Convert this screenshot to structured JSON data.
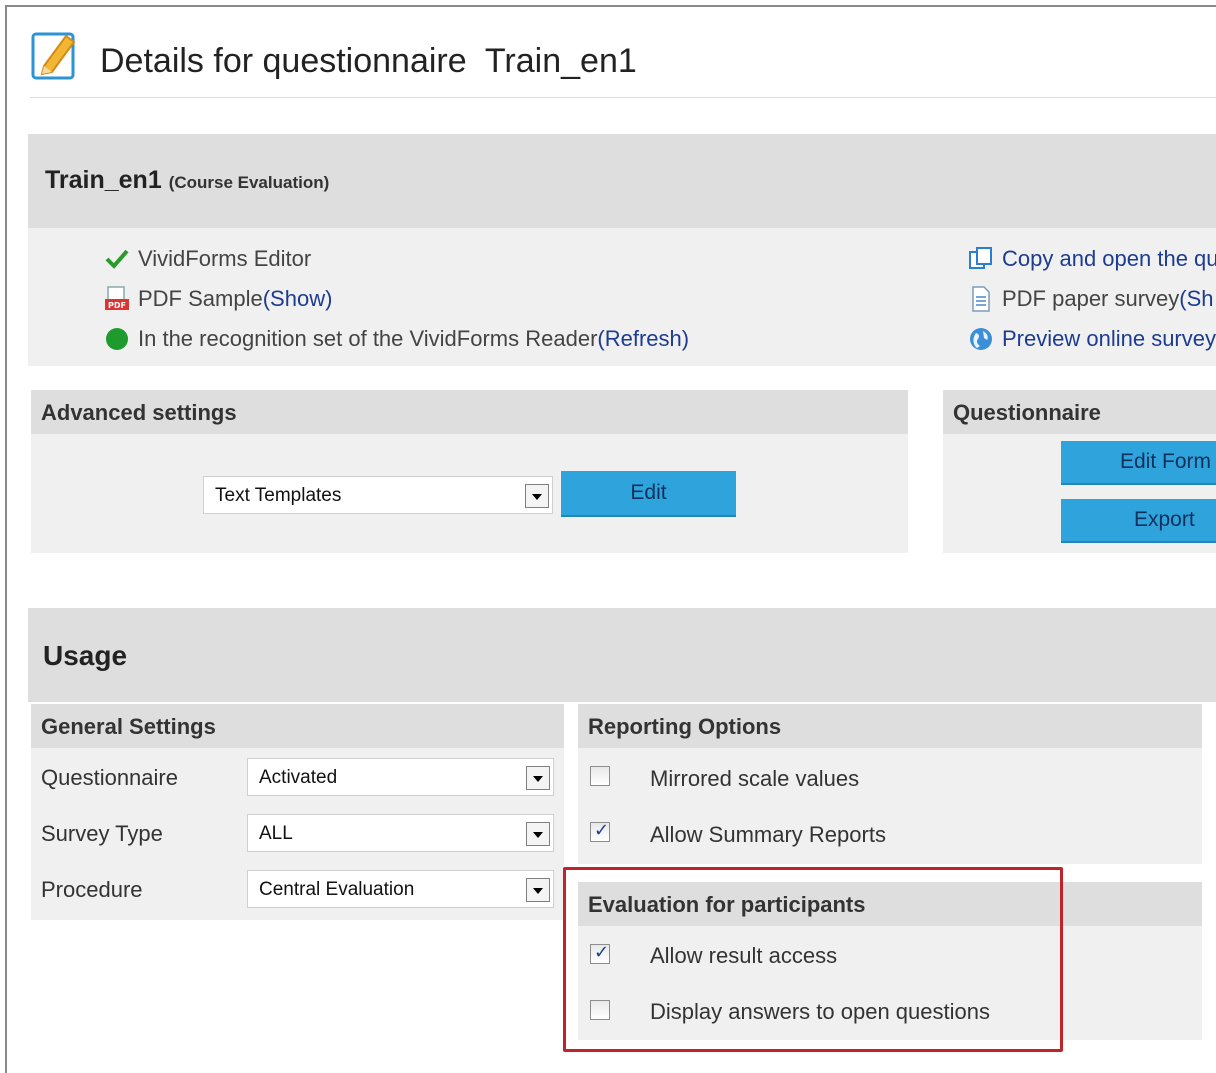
{
  "page": {
    "title": "Details for questionnaire  Train_en1"
  },
  "summary": {
    "name": "Train_en1",
    "type": "(Course Evaluation)",
    "left_items": [
      {
        "text": "VividForms Editor",
        "link": "",
        "icon": "checkmark-icon"
      },
      {
        "text": "PDF Sample ",
        "link": "(Show)",
        "icon": "pdf-icon"
      },
      {
        "text": "In the recognition set of the VividForms Reader ",
        "link": "(Refresh)",
        "icon": "green-status-dot-icon"
      }
    ],
    "right_items": [
      {
        "text": "Copy and open the qu",
        "icon": "copy-icon"
      },
      {
        "text": "PDF paper survey ",
        "link": "(Sh",
        "icon": "document-icon"
      },
      {
        "text": "Preview online survey",
        "icon": "globe-icon"
      }
    ]
  },
  "advanced": {
    "title": "Advanced settings",
    "select_value": "Text Templates",
    "edit_label": "Edit"
  },
  "questionnaire_panel": {
    "title": "Questionnaire",
    "edit_form_label": "Edit Form",
    "export_label": "Export"
  },
  "usage": {
    "title": "Usage",
    "general": {
      "title": "General Settings",
      "fields": [
        {
          "label": "Questionnaire",
          "value": "Activated"
        },
        {
          "label": "Survey Type",
          "value": "ALL"
        },
        {
          "label": "Procedure",
          "value": "Central Evaluation"
        }
      ]
    },
    "reporting": {
      "title": "Reporting Options",
      "options": [
        {
          "label": "Mirrored scale values",
          "checked": false
        },
        {
          "label": "Allow Summary Reports",
          "checked": true
        }
      ]
    },
    "evaluation": {
      "title": "Evaluation for participants",
      "options": [
        {
          "label": "Allow result access",
          "checked": true
        },
        {
          "label": "Display answers to open questions",
          "checked": false
        }
      ]
    }
  },
  "colors": {
    "button": "#2ea3dc",
    "link": "#1d3c8f",
    "highlight": "#c0232a",
    "panel": "#f0f0f0",
    "panel_head": "#dedede"
  }
}
